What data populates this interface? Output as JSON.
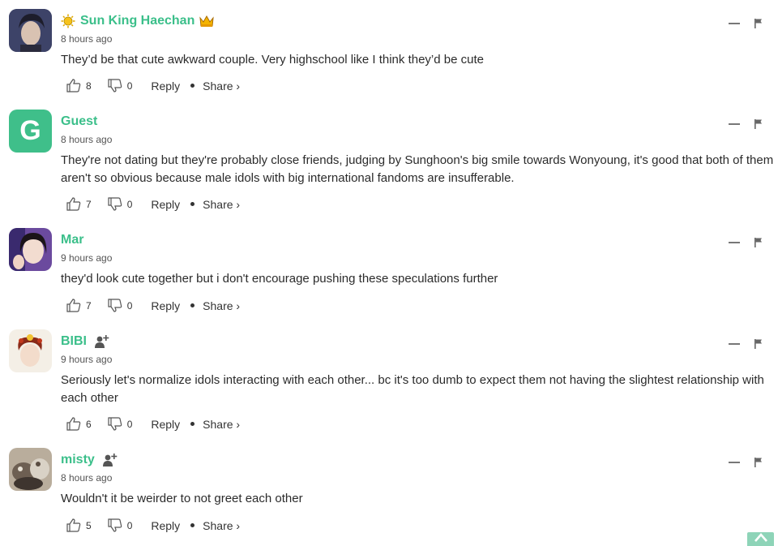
{
  "comments": [
    {
      "name": "Sun King Haechan",
      "time": "8 hours ago",
      "text": "They’d be that cute awkward couple. Very highschool like I think they’d be cute",
      "likes": "8",
      "dislikes": "0",
      "reply_label": "Reply",
      "share_label": "Share ›",
      "badges": [
        "sun-icon",
        "crown-icon"
      ]
    },
    {
      "name": "Guest",
      "avatar_letter": "G",
      "time": "8 hours ago",
      "text": "They're not dating but they're probably close friends, judging by Sunghoon's big smile towards Wonyoung, it's good that both of them aren't so obvious because male idols with big international fandoms are insufferable.",
      "likes": "7",
      "dislikes": "0",
      "reply_label": "Reply",
      "share_label": "Share ›"
    },
    {
      "name": "Mar",
      "time": "9 hours ago",
      "text": "they'd look cute together but i don't encourage pushing these speculations further",
      "likes": "7",
      "dislikes": "0",
      "reply_label": "Reply",
      "share_label": "Share ›"
    },
    {
      "name": "BIBI",
      "time": "9 hours ago",
      "text": "Seriously let's normalize idols interacting with each other... bc it's too dumb to expect them not having the slightest relationship with each other",
      "likes": "6",
      "dislikes": "0",
      "reply_label": "Reply",
      "share_label": "Share ›"
    },
    {
      "name": "misty",
      "time": "8 hours ago",
      "text": "Wouldn't it be weirder to not greet each other",
      "likes": "5",
      "dislikes": "0",
      "reply_label": "Reply",
      "share_label": "Share ›"
    }
  ],
  "colors": {
    "name": "#3bbf8a",
    "guest_avatar": "#3fbf8a",
    "scroll_top": "#8ed4b8"
  }
}
